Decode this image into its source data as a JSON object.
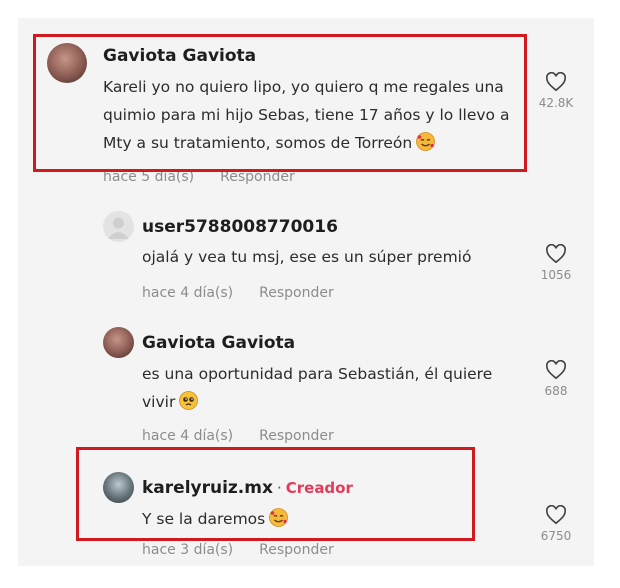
{
  "comments": [
    {
      "username": "Gaviota Gaviota",
      "lines": [
        "Kareli yo no quiero lipo, yo quiero q me regales una",
        "quimio para mi hijo Sebas, tiene 17 años y lo llevo a",
        "Mty a su tratamiento, somos de Torreón"
      ],
      "emoji": "smiling-face-with-hearts",
      "time": "hace 5 día(s)",
      "reply": "Responder",
      "likes": "42.8K"
    },
    {
      "username": "user5788008770016",
      "lines": [
        "ojalá y vea tu msj, ese es un súper premió"
      ],
      "time": "hace 4 día(s)",
      "reply": "Responder",
      "likes": "1056"
    },
    {
      "username": "Gaviota Gaviota",
      "lines": [
        "es una oportunidad para Sebastián, él quiere",
        "vivir"
      ],
      "emoji": "pleading-face",
      "time": "hace 4 día(s)",
      "reply": "Responder",
      "likes": "688"
    },
    {
      "username": "karelyruiz.mx",
      "separator": "·",
      "badge": "Creador",
      "lines": [
        "Y se la daremos"
      ],
      "emoji": "smiling-face-with-hearts",
      "time": "hace 3 día(s)",
      "reply": "Responder",
      "likes": "6750"
    }
  ],
  "colors": {
    "highlight": "#d11a20",
    "creator_badge": "#e33b5a",
    "background": "#f4f4f4"
  }
}
